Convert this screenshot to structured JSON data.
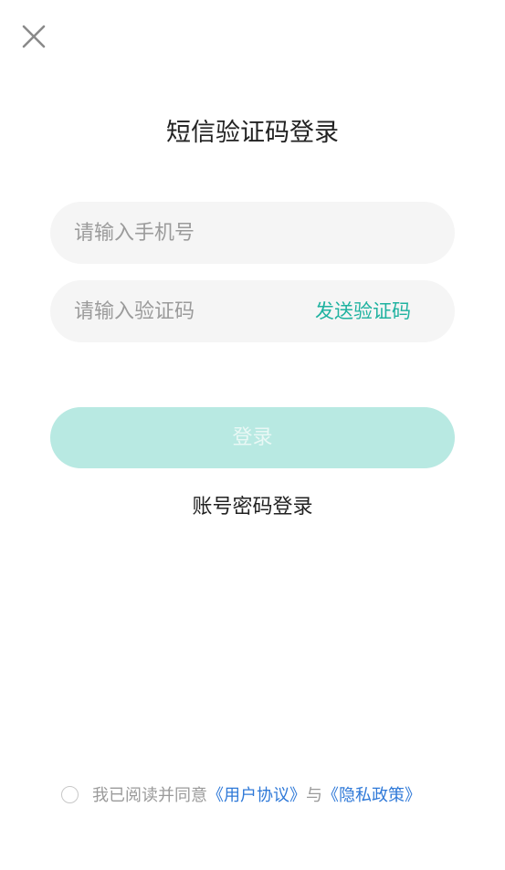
{
  "header": {
    "close_icon": "close-icon",
    "title": "短信验证码登录"
  },
  "form": {
    "phone_placeholder": "请输入手机号",
    "code_placeholder": "请输入验证码",
    "send_code_label": "发送验证码",
    "login_label": "登录",
    "password_login_label": "账号密码登录"
  },
  "agreement": {
    "prefix": "我已阅读并同意",
    "user_agreement": "《用户协议》",
    "connector": "与",
    "privacy_policy": "《隐私政策》"
  },
  "colors": {
    "accent": "#1fb2a0",
    "button_disabled_bg": "#b8e9e2",
    "link": "#2f79d8",
    "field_bg": "#f5f5f5"
  }
}
